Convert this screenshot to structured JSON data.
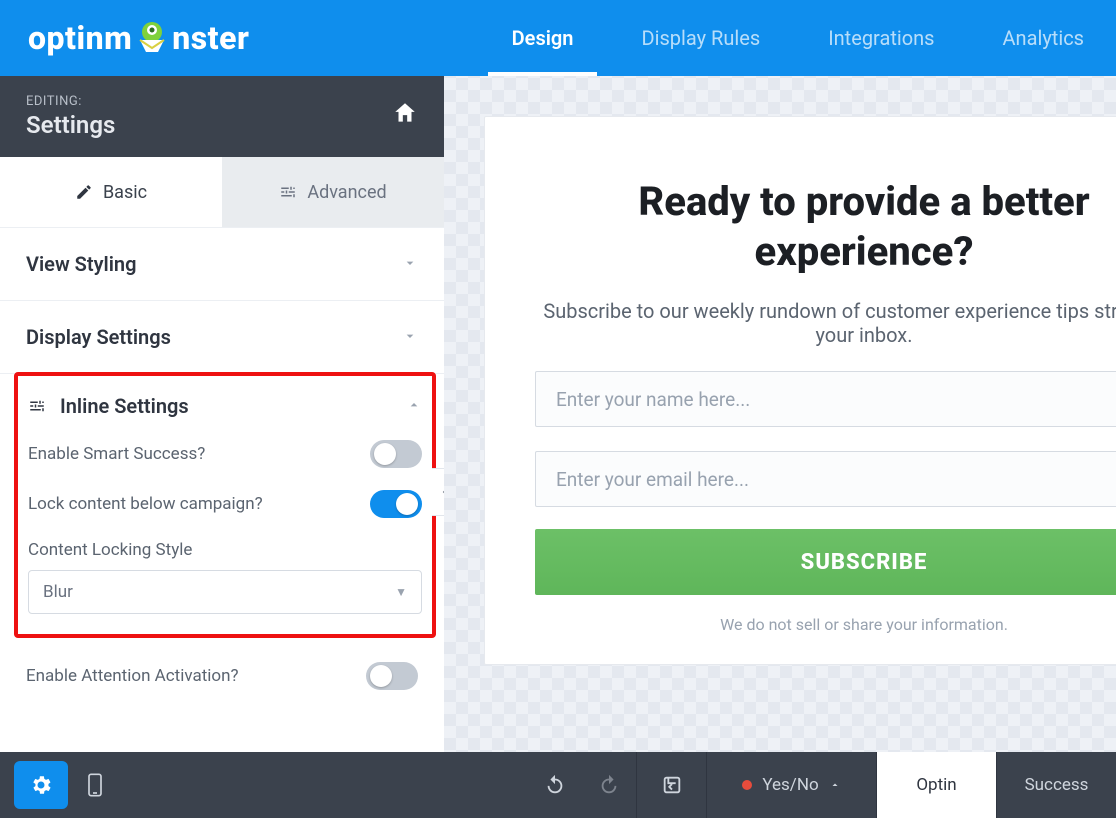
{
  "brand": {
    "name_pre": "optinm",
    "name_post": "nster"
  },
  "topnav": {
    "items": [
      "Design",
      "Display Rules",
      "Integrations",
      "Analytics"
    ],
    "active_index": 0
  },
  "side_header": {
    "label": "EDITING:",
    "title": "Settings"
  },
  "tabs": {
    "basic": "Basic",
    "advanced": "Advanced",
    "active": "basic"
  },
  "sections": {
    "view_styling": "View Styling",
    "display_settings": "Display Settings",
    "inline_settings": {
      "title": "Inline Settings",
      "enable_smart_success": {
        "label": "Enable Smart Success?",
        "on": false
      },
      "lock_content": {
        "label": "Lock content below campaign?",
        "on": true
      },
      "content_locking_style": {
        "label": "Content Locking Style",
        "value": "Blur"
      }
    },
    "attention_activation": {
      "label": "Enable Attention Activation?",
      "on": false
    }
  },
  "preview": {
    "heading": "Ready to provide a better experience?",
    "sub": "Subscribe to our weekly rundown of customer experience tips straight to your inbox.",
    "name_placeholder": "Enter your name here...",
    "email_placeholder": "Enter your email here...",
    "button": "SUBSCRIBE",
    "note": "We do not sell or share your information."
  },
  "footer": {
    "steps": {
      "yesno": "Yes/No",
      "optin": "Optin",
      "success": "Success"
    },
    "active_step": "optin"
  }
}
